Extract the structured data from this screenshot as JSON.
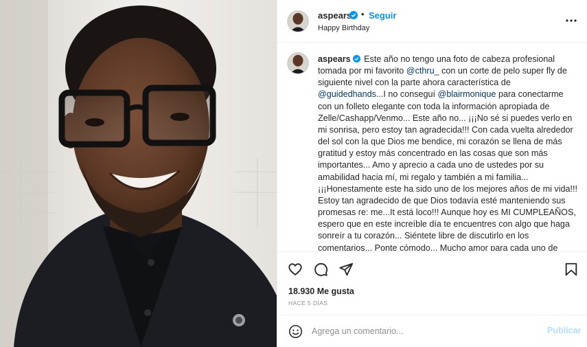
{
  "post": {
    "username": "aspears",
    "follow_label": "Seguir",
    "dot": "•",
    "subtitle": "Happy Birthday"
  },
  "caption": {
    "username": "aspears",
    "parts": [
      " Este año no tengo una foto de cabeza profesional tomada por mi favorito ",
      "@cthru_",
      " con un corte de pelo super fly de siguiente nivel con la parte ahora característica de ",
      "@guidedhands",
      "...I no conseguí ",
      "@blairmonique",
      " para conectarme con un folleto elegante con toda la información apropiada de Zelle/Cashapp/Venmo... Este año no... ¡¡¡No sé si puedes verlo en mi sonrisa, pero estoy tan agradecida!!! Con cada vuelta alrededor del sol con la que Dios me bendice, mi corazón se llena de más gratitud y estoy más concentrado en las cosas que son más importantes... Amo y aprecio a cada uno de ustedes por su amabilidad hacia mí, mi regalo y también a mi familia... ¡¡¡Honestamente este ha sido uno de los mejores años de mi vida!!! Estoy tan agradecido de que Dios todavía esté manteniendo sus promesas re: me...It está loco!!! Aunque hoy es MI CUMPLEAÑOS, espero que en este increíble día te encuentres con algo que haga sonreír a tu corazón... Siéntete libre de discutirlo en los comentarios... Ponte cómodo... Mucho amor para cada uno de ustedes... Gracias de nuevo..."
    ]
  },
  "stats": {
    "likes": "18.930 Me gusta",
    "time_ago": "HACE 5 DÍAS"
  },
  "comment": {
    "placeholder": "Agrega un comentario...",
    "publish_label": "Publicar"
  },
  "icons": {
    "verified": "verified-badge-icon",
    "more": "more-options-icon",
    "like": "heart-icon",
    "comment": "comment-icon",
    "share": "share-icon",
    "save": "bookmark-icon",
    "emoji": "emoji-icon"
  },
  "colors": {
    "link": "#0095f6",
    "mention": "#00376b",
    "verified": "#0095f6",
    "muted": "#8e8e8e",
    "publish_disabled": "#b2dffc"
  }
}
